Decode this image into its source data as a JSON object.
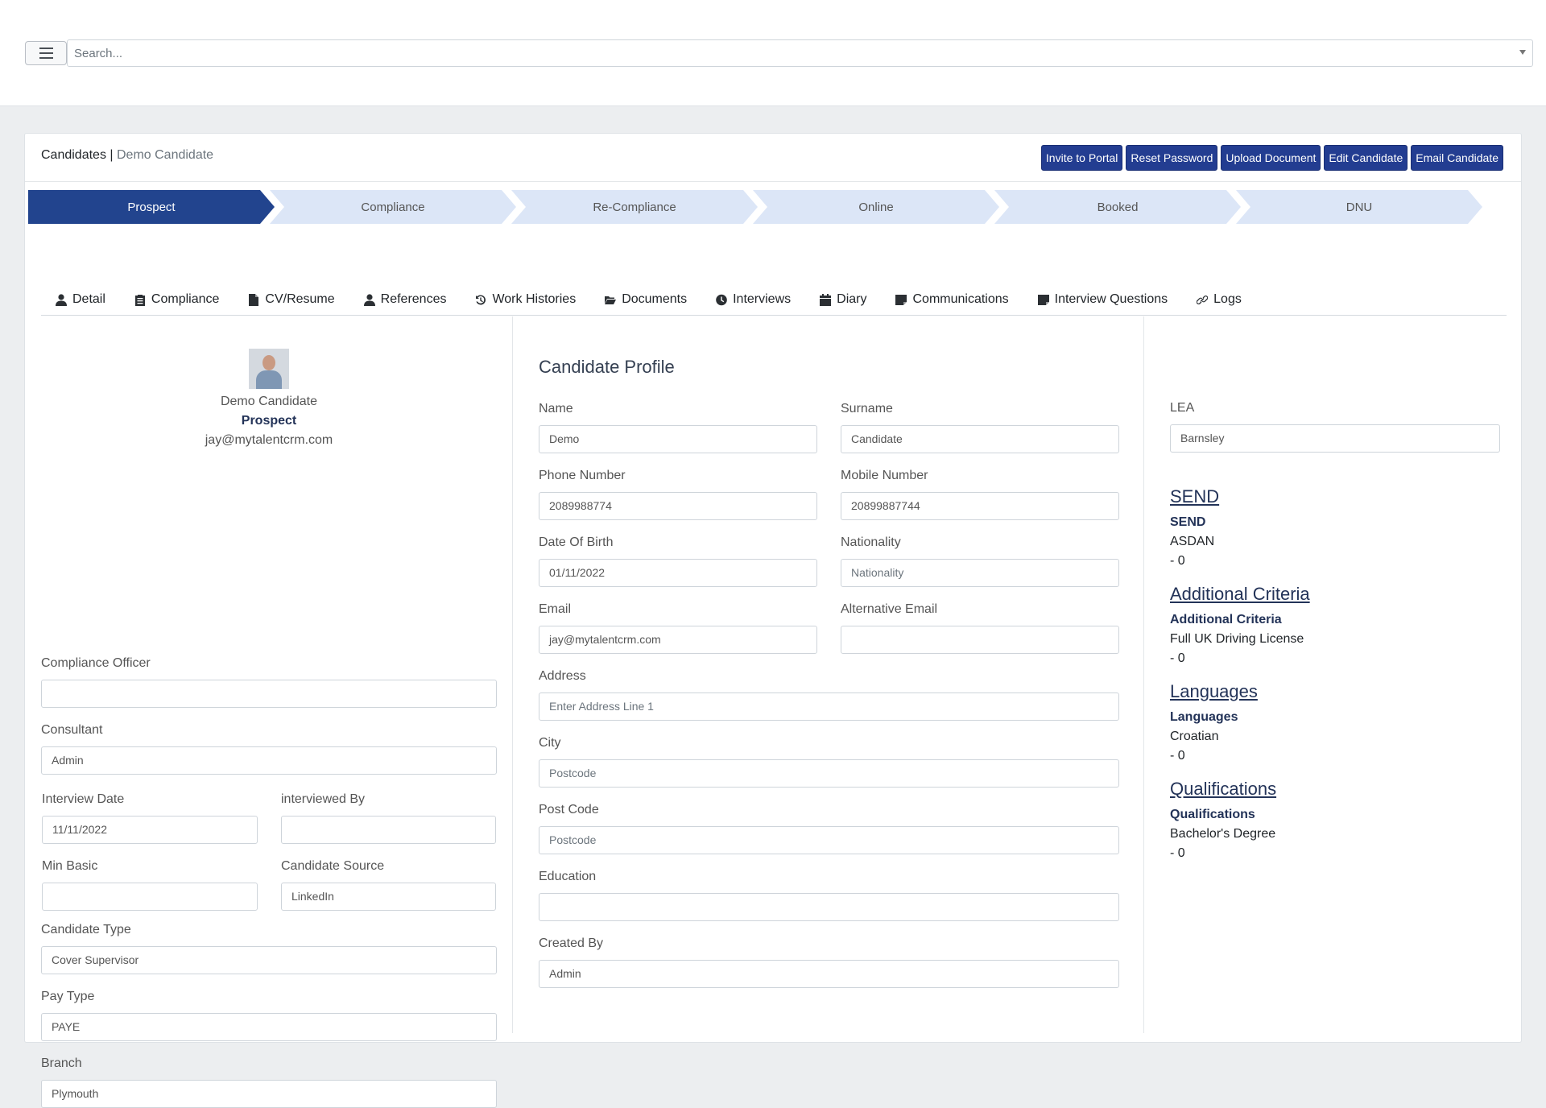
{
  "search": {
    "placeholder": "Search..."
  },
  "breadcrumb": {
    "section": "Candidates",
    "separator": " | ",
    "current": "Demo Candidate"
  },
  "actions": [
    {
      "label": "Invite to Portal"
    },
    {
      "label": "Reset Password"
    },
    {
      "label": "Upload Document"
    },
    {
      "label": "Edit Candidate"
    },
    {
      "label": "Email Candidate"
    }
  ],
  "pipeline": {
    "active": "Prospect",
    "stages": [
      {
        "label": "Prospect"
      },
      {
        "label": "Compliance"
      },
      {
        "label": "Re-Compliance"
      },
      {
        "label": "Online"
      },
      {
        "label": "Booked"
      },
      {
        "label": "DNU"
      }
    ]
  },
  "tabs": [
    {
      "label": "Detail",
      "icon": "user-icon"
    },
    {
      "label": "Compliance",
      "icon": "clipboard-icon"
    },
    {
      "label": "CV/Resume",
      "icon": "file-icon"
    },
    {
      "label": "References",
      "icon": "user-icon"
    },
    {
      "label": "Work Histories",
      "icon": "history-icon"
    },
    {
      "label": "Documents",
      "icon": "folder-open-icon"
    },
    {
      "label": "Interviews",
      "icon": "clock-icon"
    },
    {
      "label": "Diary",
      "icon": "calendar-icon"
    },
    {
      "label": "Communications",
      "icon": "sticky-note-icon"
    },
    {
      "label": "Interview Questions",
      "icon": "sticky-note-icon"
    },
    {
      "label": "Logs",
      "icon": "link-icon"
    }
  ],
  "profile": {
    "name": "Demo Candidate",
    "stage": "Prospect",
    "email": "jay@mytalentcrm.com"
  },
  "left_fields": {
    "compliance_officer": {
      "label": "Compliance Officer",
      "value": ""
    },
    "consultant": {
      "label": "Consultant",
      "value": "Admin"
    },
    "interview_date": {
      "label": "Interview Date",
      "value": "11/11/2022"
    },
    "interviewed_by": {
      "label": "interviewed By",
      "value": ""
    },
    "min_basic": {
      "label": "Min Basic",
      "value": ""
    },
    "candidate_source": {
      "label": "Candidate Source",
      "value": "LinkedIn"
    },
    "candidate_type": {
      "label": "Candidate Type",
      "value": "Cover Supervisor"
    },
    "pay_type": {
      "label": "Pay Type",
      "value": "PAYE"
    },
    "branch": {
      "label": "Branch",
      "value": "Plymouth"
    }
  },
  "candidate_profile": {
    "title": "Candidate Profile",
    "name": {
      "label": "Name",
      "value": "Demo"
    },
    "surname": {
      "label": "Surname",
      "value": "Candidate"
    },
    "phone": {
      "label": "Phone Number",
      "value": "2089988774"
    },
    "mobile": {
      "label": "Mobile Number",
      "value": "20899887744"
    },
    "dob": {
      "label": "Date Of Birth",
      "value": "01/11/2022"
    },
    "nationality": {
      "label": "Nationality",
      "placeholder": "Nationality"
    },
    "email": {
      "label": "Email",
      "value": "jay@mytalentcrm.com"
    },
    "alt_email": {
      "label": "Alternative Email",
      "value": ""
    },
    "address": {
      "label": "Address",
      "placeholder": "Enter Address Line 1"
    },
    "city": {
      "label": "City",
      "placeholder": "Postcode"
    },
    "postcode": {
      "label": "Post Code",
      "placeholder": "Postcode"
    },
    "education": {
      "label": "Education",
      "value": ""
    },
    "created_by": {
      "label": "Created By",
      "value": "Admin"
    }
  },
  "right": {
    "lea": {
      "label": "LEA",
      "value": "Barnsley"
    },
    "sections": [
      {
        "heading": "SEND",
        "sub": "SEND",
        "value": "ASDAN",
        "count": "- 0"
      },
      {
        "heading": "Additional Criteria",
        "sub": "Additional Criteria",
        "value": "Full UK Driving License",
        "count": "- 0"
      },
      {
        "heading": "Languages",
        "sub": "Languages",
        "value": "Croatian",
        "count": "- 0"
      },
      {
        "heading": "Qualifications",
        "sub": "Qualifications",
        "value": "Bachelor's Degree",
        "count": "- 0"
      }
    ]
  },
  "colors": {
    "primary": "#233d91",
    "stage_active": "#22448e",
    "stage_inactive": "#dce6f7",
    "heading": "#233358"
  }
}
